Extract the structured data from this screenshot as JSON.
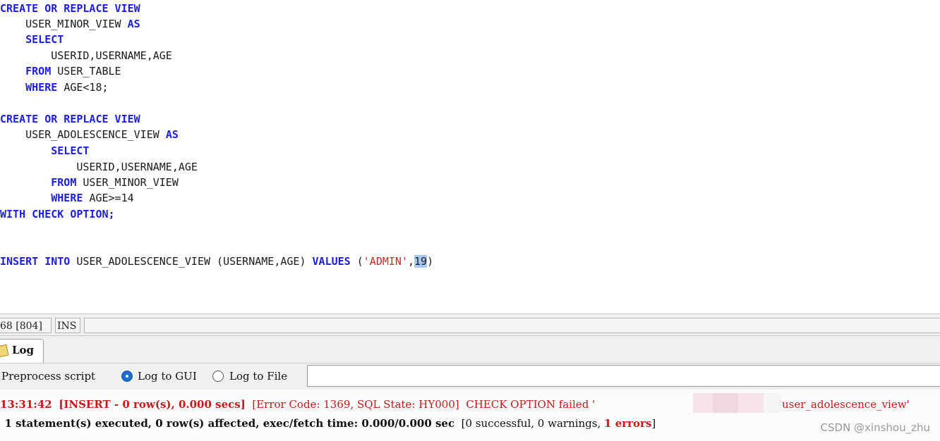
{
  "editor": {
    "block1": {
      "l1_kw": "CREATE OR REPLACE VIEW",
      "l2_name": "USER_MINOR_VIEW",
      "l2_kw": "AS",
      "l3_kw": "SELECT",
      "l4_cols": "USERID,USERNAME,AGE",
      "l5_kw": "FROM",
      "l5_tbl": "USER_TABLE",
      "l6_kw": "WHERE",
      "l6_cond": "AGE<18;"
    },
    "block2": {
      "l1_kw": "CREATE OR REPLACE VIEW",
      "l2_name": "USER_ADOLESCENCE_VIEW",
      "l2_kw": "AS",
      "l3_kw": "SELECT",
      "l4_cols": "USERID,USERNAME,AGE",
      "l5_kw": "FROM",
      "l5_tbl": "USER_MINOR_VIEW",
      "l6_kw": "WHERE",
      "l6_cond": "AGE>=14",
      "l7_kw": "WITH CHECK OPTION;"
    },
    "insert": {
      "kw1": "INSERT INTO",
      "target": "USER_ADOLESCENCE_VIEW (USERNAME,AGE)",
      "kw2": "VALUES",
      "open": "(",
      "str": "'ADMIN'",
      "comma": ",",
      "num": "19",
      "close": ")"
    }
  },
  "statusbar": {
    "pos": "68 [804]",
    "mode": "INS"
  },
  "tabs": {
    "log_label": "Log"
  },
  "options": {
    "preprocess": "Preprocess script",
    "log_gui": "Log to GUI",
    "log_file": "Log to File",
    "log_gui_selected": true
  },
  "log": {
    "line1": {
      "time": "13:31:42",
      "status": "[INSERT - 0 row(s), 0.000 secs]",
      "error": "[Error Code: 1369, SQL State: HY000]  CHECK OPTION failed '",
      "view": "user_adolescence_view'"
    },
    "line2": {
      "prefix": ". 1 statement(s) executed, 0 row(s) affected, exec/fetch time: 0.000/0.000 sec",
      "summary": "[0 successful, 0 warnings,",
      "errors": "1 errors",
      "close": "]"
    }
  },
  "watermark": "CSDN @xinshou_zhu",
  "colors": {
    "keyword": "#1d1de8",
    "string": "#e02020",
    "error": "#c51a1a",
    "selection": "#a9c9f5"
  }
}
